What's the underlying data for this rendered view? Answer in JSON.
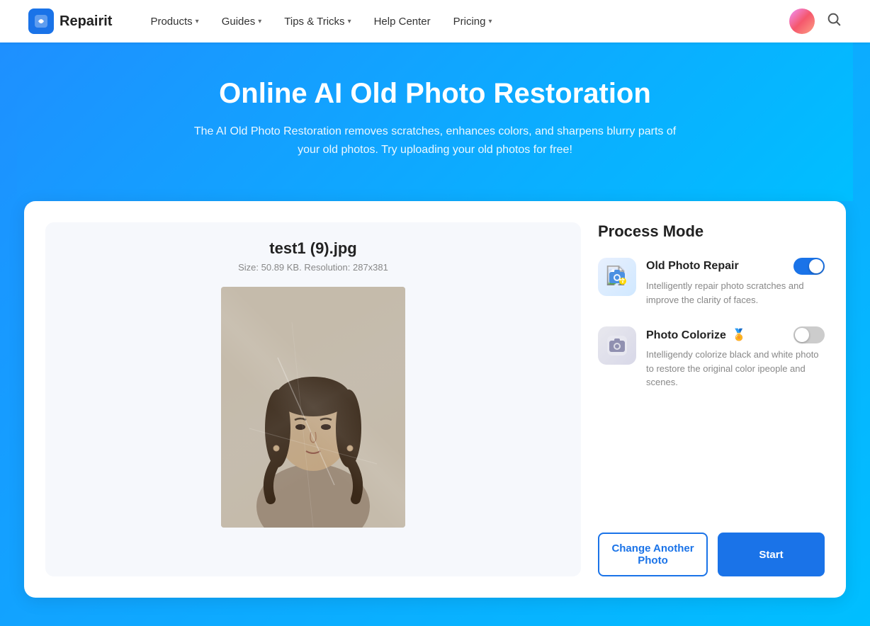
{
  "navbar": {
    "logo_icon": "R",
    "logo_text": "Repairit",
    "items": [
      {
        "label": "Products",
        "has_dropdown": true
      },
      {
        "label": "Guides",
        "has_dropdown": true
      },
      {
        "label": "Tips & Tricks",
        "has_dropdown": true
      },
      {
        "label": "Help Center",
        "has_dropdown": false
      },
      {
        "label": "Pricing",
        "has_dropdown": true
      }
    ],
    "search_icon": "🔍"
  },
  "hero": {
    "title": "Online AI Old Photo Restoration",
    "subtitle": "The AI Old Photo Restoration removes scratches, enhances colors, and sharpens blurry parts of your old photos. Try uploading your old photos for free!"
  },
  "file": {
    "name": "test1 (9).jpg",
    "meta": "Size: 50.89 KB. Resolution: 287x381"
  },
  "process_mode": {
    "title": "Process Mode",
    "modes": [
      {
        "id": "old-photo-repair",
        "name": "Old Photo Repair",
        "badge": "",
        "toggle_on": true,
        "description": "Intelligently repair photo scratches and improve the clarity of faces."
      },
      {
        "id": "photo-colorize",
        "name": "Photo Colorize",
        "badge": "🏅",
        "toggle_on": false,
        "description": "Intelligendy colorize black and white photo to restore the original color ipeople and scenes."
      }
    ]
  },
  "buttons": {
    "change_photo": "Change Another Photo",
    "start": "Start"
  }
}
